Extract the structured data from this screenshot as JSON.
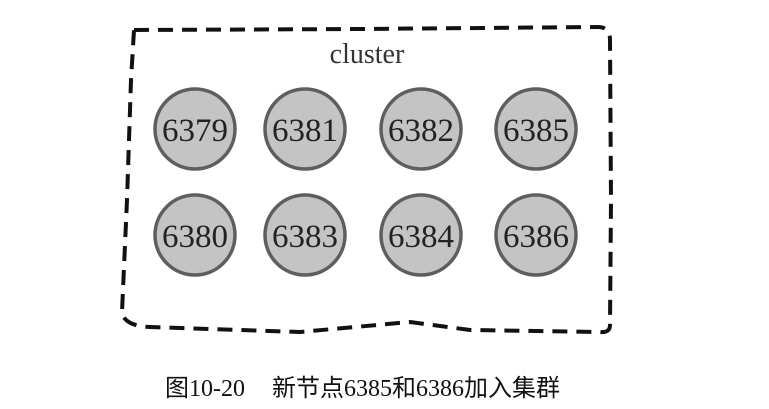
{
  "cluster": {
    "label": "cluster"
  },
  "nodes": {
    "rows": [
      [
        "6379",
        "6381",
        "6382",
        "6385"
      ],
      [
        "6380",
        "6383",
        "6384",
        "6386"
      ]
    ]
  },
  "caption": {
    "figure_number": "图10-20",
    "text": "新节点6385和6386加入集群"
  },
  "colors": {
    "boundary": "#111111",
    "node_fill": "#c4c4c4",
    "node_stroke": "#5e5e5e"
  }
}
